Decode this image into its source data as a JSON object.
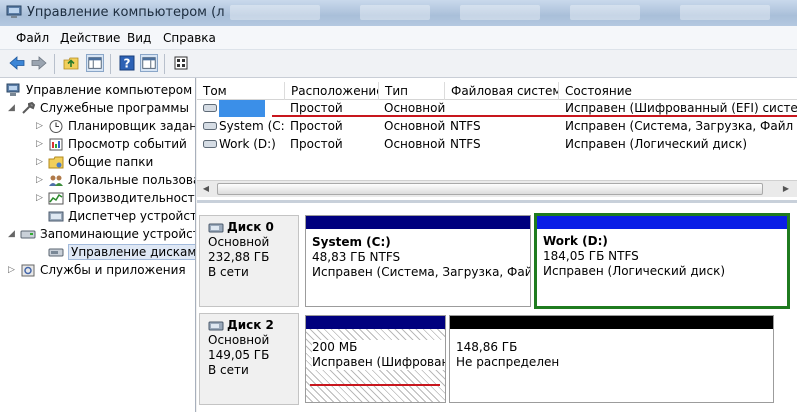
{
  "window": {
    "title": "Управление компьютером (л"
  },
  "menu": [
    "Файл",
    "Действие",
    "Вид",
    "Справка"
  ],
  "tree": {
    "root": "Управление компьютером (л",
    "items": [
      {
        "label": "Служебные программы",
        "level": 1,
        "expand": "◢"
      },
      {
        "label": "Планировщик заданий",
        "level": 2,
        "expand": "▷"
      },
      {
        "label": "Просмотр событий",
        "level": 2,
        "expand": "▷"
      },
      {
        "label": "Общие папки",
        "level": 2,
        "expand": "▷"
      },
      {
        "label": "Локальные пользовате",
        "level": 2,
        "expand": "▷"
      },
      {
        "label": "Производительность",
        "level": 2,
        "expand": "▷"
      },
      {
        "label": "Диспетчер устройств",
        "level": 2,
        "expand": ""
      },
      {
        "label": "Запоминающие устройст",
        "level": 1,
        "expand": "◢"
      },
      {
        "label": "Управление дисками",
        "level": 2,
        "expand": "",
        "selected": true
      },
      {
        "label": "Службы и приложения",
        "level": 1,
        "expand": "▷"
      }
    ]
  },
  "volumes": {
    "columns": [
      "Том",
      "Расположение",
      "Тип",
      "Файловая система",
      "Состояние"
    ],
    "rows": [
      {
        "name": "",
        "layout": "Простой",
        "type": "Основной",
        "fs": "",
        "status": "Исправен (Шифрованный (EFI) системны"
      },
      {
        "name": "System (C:)",
        "layout": "Простой",
        "type": "Основной",
        "fs": "NTFS",
        "status": "Исправен (Система, Загрузка, Файл подк"
      },
      {
        "name": "Work (D:)",
        "layout": "Простой",
        "type": "Основной",
        "fs": "NTFS",
        "status": "Исправен (Логический диск)"
      }
    ]
  },
  "disks": [
    {
      "name": "Диск 0",
      "kind": "Основной",
      "size": "232,88 ГБ",
      "state": "В сети",
      "partitions": [
        {
          "name": "System  (C:)",
          "size": "48,83 ГБ NTFS",
          "status": "Исправен (Система, Загрузка, Файл по"
        },
        {
          "name": "Work  (D:)",
          "size": "184,05 ГБ NTFS",
          "status": "Исправен (Логический диск)"
        }
      ]
    },
    {
      "name": "Диск 2",
      "kind": "Основной",
      "size": "149,05 ГБ",
      "state": "В сети",
      "partitions": [
        {
          "name": "",
          "size": "200 МБ",
          "status": "Исправен (Шифрованн"
        },
        {
          "name": "",
          "size": "148,86 ГБ",
          "status": "Не распределен"
        }
      ]
    }
  ],
  "colors": {
    "primary_bar": "#00007e",
    "selected_border": "#1f7b1f",
    "unallocated_bar": "#000000",
    "hidden_name": "#3b8fe8",
    "annotation": "#c8161d"
  }
}
